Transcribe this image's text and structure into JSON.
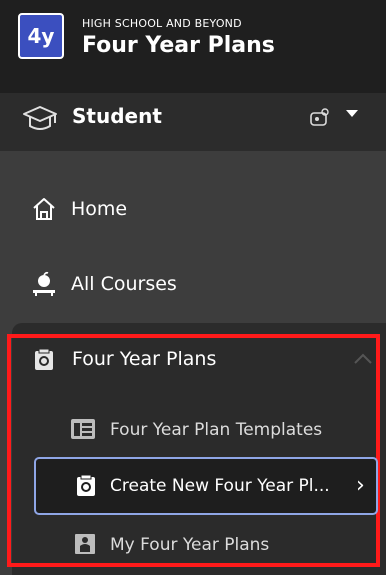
{
  "header": {
    "logo_text": "4y",
    "subtitle": "HIGH SCHOOL AND BEYOND",
    "title": "Four Year Plans"
  },
  "role": {
    "label": "Student",
    "icon": "graduation-cap-icon",
    "switch_icon": "role-switch-icon"
  },
  "nav": {
    "home": {
      "label": "Home",
      "icon": "home-icon"
    },
    "all_courses": {
      "label": "All Courses",
      "icon": "apple-desk-icon"
    }
  },
  "section": {
    "label": "Four Year Plans",
    "icon": "planner-icon",
    "expanded": true,
    "items": [
      {
        "label": "Four Year Plan Templates",
        "icon": "template-icon"
      },
      {
        "label": "Create New Four Year Pl...",
        "icon": "create-plan-icon",
        "selected": true
      },
      {
        "label": "My Four Year Plans",
        "icon": "student-plan-icon"
      }
    ]
  },
  "colors": {
    "header_bg": "#1f1f1f",
    "sidebar_bg": "#3d3d3d",
    "section_bg": "#2b2b2b",
    "logo_bg": "#3b4fbf",
    "highlight": "#ff1a1a",
    "selected_border": "#8fa6e6"
  }
}
